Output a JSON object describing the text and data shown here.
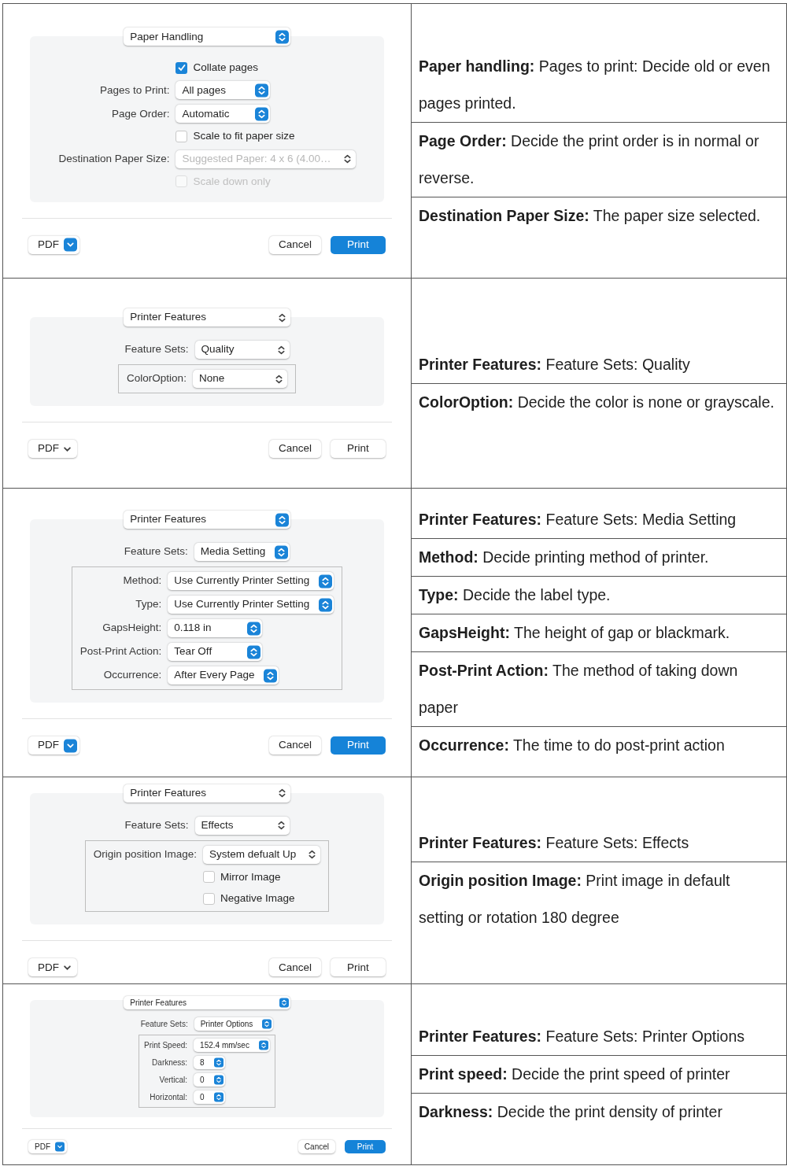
{
  "rows": [
    {
      "dialog": {
        "focused": true,
        "panel": {
          "label": "Paper Handling"
        },
        "items": [
          {
            "kind": "checkbox",
            "label": "Collate pages",
            "checked": true,
            "disabled": false
          },
          {
            "kind": "popup",
            "label": "Pages to Print:",
            "value": "All pages",
            "disabled": false
          },
          {
            "kind": "popup",
            "label": "Page Order:",
            "value": "Automatic",
            "disabled": false
          },
          {
            "kind": "checkbox",
            "label": "Scale to fit paper size",
            "checked": false,
            "disabled": false
          },
          {
            "kind": "popup",
            "label": "Destination Paper Size:",
            "value": "Suggested Paper: 4 x 6 (4.00…",
            "disabled": true
          },
          {
            "kind": "checkbox",
            "label": "Scale down only",
            "checked": false,
            "disabled": true
          }
        ],
        "footer": {
          "menu": "PDF",
          "cancel": "Cancel",
          "print": "Print"
        }
      },
      "notes": [
        "**Paper handling:** Pages to print: Decide old or even pages printed.",
        "**Page Order:** Decide the print order is in normal or reverse.",
        "**Destination Paper Size:** The paper size selected."
      ]
    },
    {
      "dialog": {
        "focused": false,
        "panel": {
          "label": "Printer Features"
        },
        "items": [
          {
            "kind": "popup",
            "label": "Feature Sets:",
            "value": "Quality",
            "disabled": false
          },
          {
            "kind": "group",
            "items": [
              {
                "kind": "popup",
                "label": "ColorOption:",
                "value": "None",
                "disabled": false
              }
            ]
          }
        ],
        "footer": {
          "menu": "PDF",
          "cancel": "Cancel",
          "print": "Print"
        }
      },
      "notes": [
        "**Printer Features:** Feature Sets: Quality",
        "**ColorOption:** Decide the color is none or grayscale."
      ]
    },
    {
      "dialog": {
        "focused": true,
        "panel": {
          "label": "Printer Features"
        },
        "items": [
          {
            "kind": "popup",
            "label": "Feature Sets:",
            "value": "Media Setting",
            "disabled": false
          },
          {
            "kind": "group",
            "items": [
              {
                "kind": "popup",
                "label": "Method:",
                "value": "Use Currently Printer Setting",
                "disabled": false
              },
              {
                "kind": "popup",
                "label": "Type:",
                "value": "Use Currently Printer Setting",
                "disabled": false
              },
              {
                "kind": "popup",
                "label": "GapsHeight:",
                "value": "0.118 in",
                "disabled": false
              },
              {
                "kind": "popup",
                "label": "Post-Print Action:",
                "value": "Tear Off",
                "disabled": false
              },
              {
                "kind": "popup",
                "label": "Occurrence:",
                "value": "After Every Page",
                "disabled": false
              }
            ]
          }
        ],
        "footer": {
          "menu": "PDF",
          "cancel": "Cancel",
          "print": "Print"
        }
      },
      "notes": [
        "**Printer Features:** Feature Sets: Media Setting",
        "**Method:** Decide printing method of printer.",
        "**Type:** Decide the label type.",
        "**GapsHeight:** The height of gap or blackmark.",
        "**Post-Print Action:** The method of taking down paper",
        "**Occurrence:** The time to do post-print action"
      ]
    },
    {
      "dialog": {
        "focused": false,
        "panel": {
          "label": "Printer Features"
        },
        "items": [
          {
            "kind": "popup",
            "label": "Feature Sets:",
            "value": "Effects",
            "disabled": false
          },
          {
            "kind": "group",
            "items": [
              {
                "kind": "popup",
                "label": "Origin position Image:",
                "value": "System defualt Up",
                "disabled": false
              },
              {
                "kind": "checkbox",
                "label": "Mirror Image",
                "checked": false,
                "disabled": false
              },
              {
                "kind": "checkbox",
                "label": "Negative Image",
                "checked": false,
                "disabled": false
              }
            ]
          }
        ],
        "footer": {
          "menu": "PDF",
          "cancel": "Cancel",
          "print": "Print"
        }
      },
      "notes": [
        "**Printer Features:** Feature Sets: Effects",
        "**Origin position Image:** Print image in default setting or rotation 180 degree"
      ]
    },
    {
      "dialog": {
        "focused": true,
        "panel": {
          "label": "Printer Features"
        },
        "items": [
          {
            "kind": "popup",
            "label": "Feature Sets:",
            "value": "Printer Options",
            "disabled": false
          },
          {
            "kind": "group",
            "items": [
              {
                "kind": "popup",
                "label": "Print Speed:",
                "value": "152.4 mm/sec",
                "disabled": false
              },
              {
                "kind": "popup",
                "label": "Darkness:",
                "value": "8",
                "disabled": false
              },
              {
                "kind": "popup",
                "label": "Vertical:",
                "value": "0",
                "disabled": false
              },
              {
                "kind": "popup",
                "label": "Horizontal:",
                "value": "0",
                "disabled": false
              }
            ]
          }
        ],
        "footer": {
          "menu": "PDF",
          "cancel": "Cancel",
          "print": "Print"
        }
      },
      "notes": [
        "**Printer Features:** Feature Sets: Printer Options",
        "**Print speed:** Decide the print speed of printer",
        "**Darkness:** Decide the print density of printer"
      ]
    }
  ]
}
